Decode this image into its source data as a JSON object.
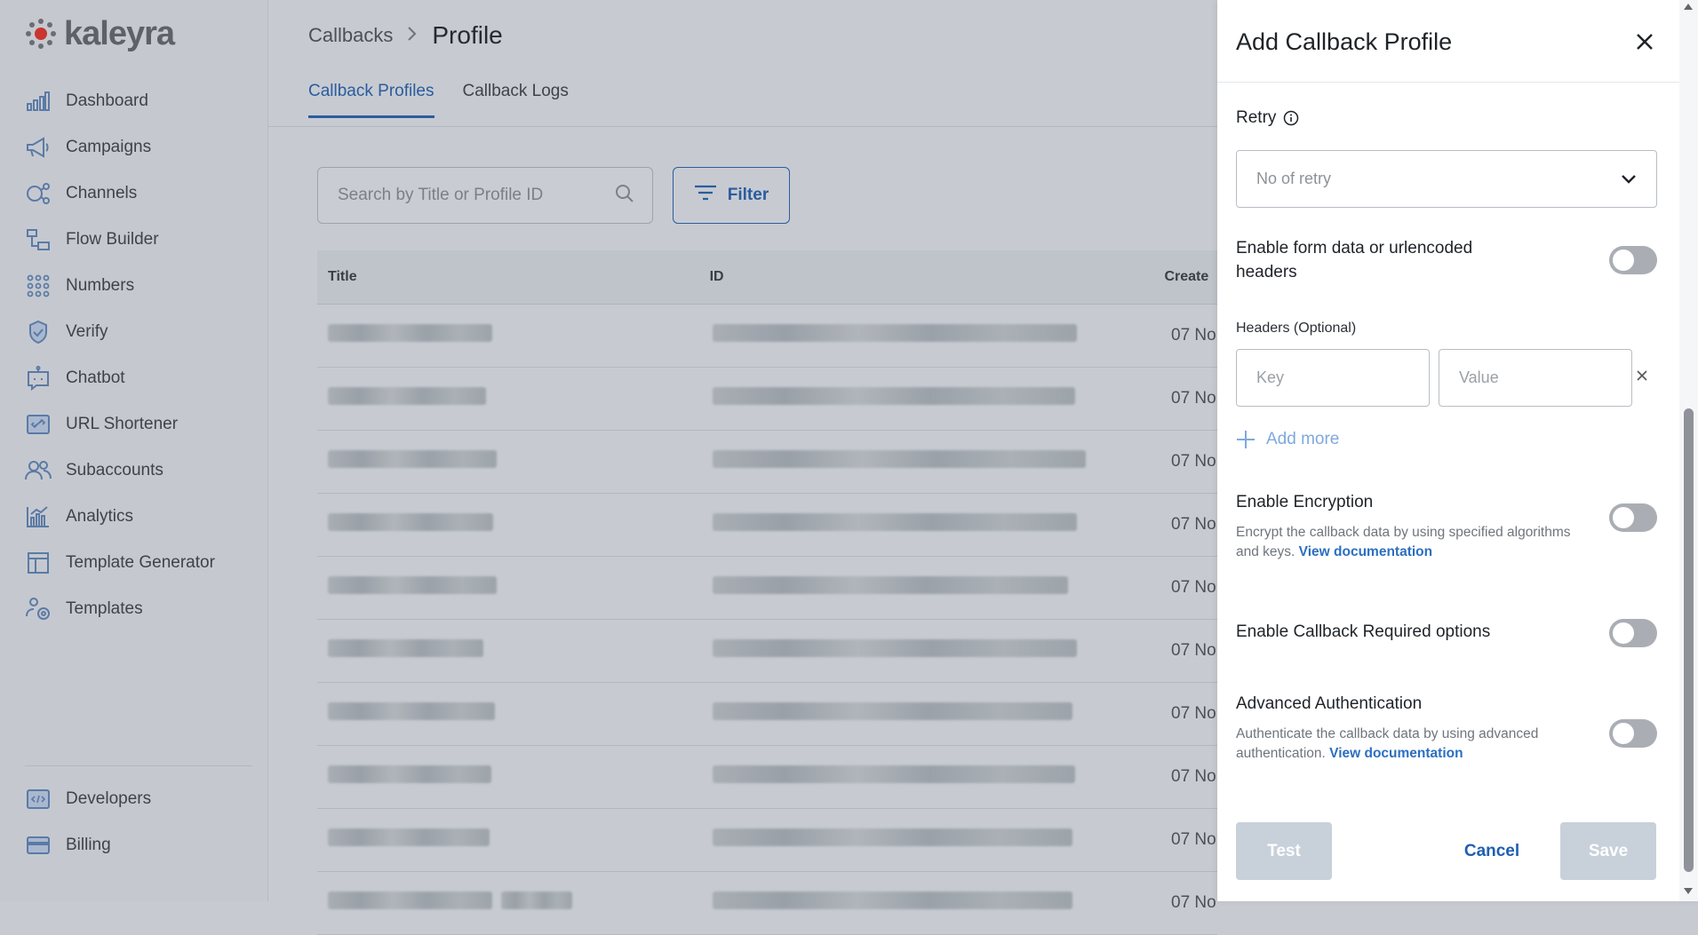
{
  "brand": {
    "name": "kaleyra"
  },
  "sidebar": {
    "items": [
      {
        "label": "Dashboard",
        "icon": "bar-chart-icon"
      },
      {
        "label": "Campaigns",
        "icon": "megaphone-icon"
      },
      {
        "label": "Channels",
        "icon": "channels-icon"
      },
      {
        "label": "Flow Builder",
        "icon": "flow-builder-icon"
      },
      {
        "label": "Numbers",
        "icon": "keypad-icon"
      },
      {
        "label": "Verify",
        "icon": "shield-check-icon"
      },
      {
        "label": "Chatbot",
        "icon": "bot-icon"
      },
      {
        "label": "URL Shortener",
        "icon": "link-icon"
      },
      {
        "label": "Subaccounts",
        "icon": "users-icon"
      },
      {
        "label": "Analytics",
        "icon": "analytics-icon"
      },
      {
        "label": "Template Generator",
        "icon": "layout-icon"
      },
      {
        "label": "Templates",
        "icon": "template-user-icon"
      }
    ],
    "bottom": [
      {
        "label": "Developers",
        "icon": "code-icon"
      },
      {
        "label": "Billing",
        "icon": "credit-card-icon"
      }
    ]
  },
  "breadcrumb": {
    "parent": "Callbacks",
    "separator": ">",
    "current": "Profile"
  },
  "tabs": [
    {
      "label": "Callback Profiles",
      "active": true
    },
    {
      "label": "Callback Logs",
      "active": false
    }
  ],
  "search": {
    "placeholder": "Search by Title or Profile ID"
  },
  "filter": {
    "label": "Filter"
  },
  "table": {
    "headers": {
      "title": "Title",
      "id": "ID",
      "created": "Create"
    },
    "rows": [
      {
        "date": "07 No"
      },
      {
        "date": "07 No"
      },
      {
        "date": "07 No"
      },
      {
        "date": "07 No"
      },
      {
        "date": "07 No"
      },
      {
        "date": "07 No"
      },
      {
        "date": "07 No"
      },
      {
        "date": "07 No"
      },
      {
        "date": "07 No"
      },
      {
        "date": "07 No"
      }
    ]
  },
  "drawer": {
    "title": "Add Callback Profile",
    "retry": {
      "label": "Retry",
      "placeholder": "No of retry"
    },
    "form_data": {
      "label_line1": "Enable form data or urlencoded",
      "label_line2": "headers"
    },
    "headers": {
      "label": "Headers (Optional)",
      "key_placeholder": "Key",
      "value_placeholder": "Value",
      "add_more": "Add more"
    },
    "encryption": {
      "label": "Enable Encryption",
      "desc_line1": "Encrypt the callback data by using specified algorithms",
      "desc_line2": "and keys.",
      "link": "View documentation"
    },
    "callback_required": {
      "label": "Enable Callback Required options"
    },
    "advanced_auth": {
      "label": "Advanced Authentication",
      "desc_line1": "Authenticate the callback data by using advanced",
      "desc_line2": "authentication.",
      "link": "View documentation"
    },
    "buttons": {
      "test": "Test",
      "cancel": "Cancel",
      "save": "Save"
    }
  },
  "colors": {
    "accent": "#2b5c9e",
    "link": "#2b6fc1",
    "disabled_button": "#c8d0da",
    "overlay": "#c7cbd1"
  }
}
